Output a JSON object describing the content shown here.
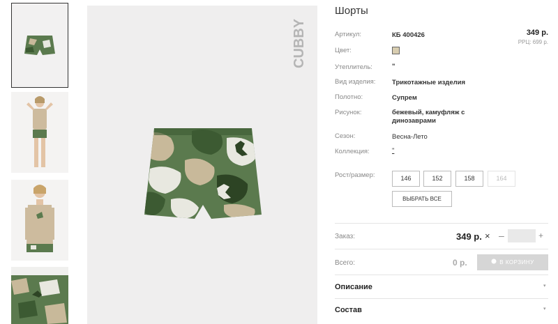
{
  "product": {
    "title": "Шорты",
    "price": "349 р.",
    "rrc": "РРЦ: 699 р.",
    "brand": "CUBBY",
    "swatch_color": "#d8cdb0"
  },
  "attributes": [
    {
      "label": "Артикул:",
      "value": "КБ 400426"
    },
    {
      "label": "Цвет:",
      "value": ""
    },
    {
      "label": "Утеплитель:",
      "value": "\""
    },
    {
      "label": "Вид изделия:",
      "value": "Трикотажные изделия"
    },
    {
      "label": "Полотно:",
      "value": "Супрем"
    },
    {
      "label": "Рисунок:",
      "value_line1": "бежевый, камуфляж с",
      "value_line2": "динозаврами"
    },
    {
      "label": "Сезон:",
      "value": "Весна-Лето"
    },
    {
      "label": "Коллекция:",
      "value": "\""
    }
  ],
  "sizes": {
    "label": "Рост/размер:",
    "options": [
      "146",
      "152",
      "158",
      "164"
    ],
    "disabled": [
      "164"
    ],
    "select_all": "ВЫБРАТЬ ВСЕ"
  },
  "order": {
    "label": "Заказ:",
    "price": "349 р.",
    "times": "×",
    "minus": "–",
    "plus": "+",
    "quantity": ""
  },
  "total": {
    "label": "Всего:",
    "value": "0 р.",
    "cart_button": "В КОРЗИНУ"
  },
  "accordion": [
    {
      "title": "Описание"
    },
    {
      "title": "Состав"
    }
  ],
  "icons": {
    "arrow": "▾"
  }
}
